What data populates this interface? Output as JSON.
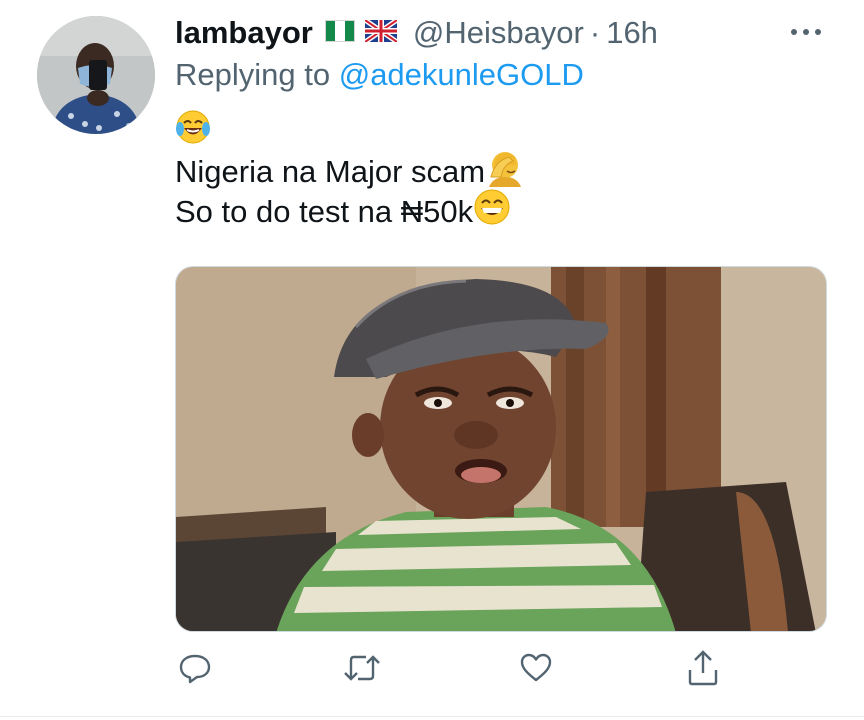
{
  "tweet": {
    "display_name": "lambayor",
    "handle": "@Heisbayor",
    "separator": "·",
    "time": "16h",
    "reply_prefix": "Replying to",
    "reply_to": "@adekunleGOLD",
    "text_lines": [
      "Nigeria na Major scam",
      "So to do test na ₦50k"
    ],
    "emojis": [
      "face-with-tears-of-joy",
      "person-facepalming",
      "grinning-face-with-smiling-eyes"
    ],
    "flags": [
      "nigeria-flag",
      "uk-flag"
    ]
  },
  "actions": [
    {
      "name": "reply-icon"
    },
    {
      "name": "retweet-icon"
    },
    {
      "name": "like-icon"
    },
    {
      "name": "share-icon"
    }
  ],
  "colors": {
    "text": "#0f1419",
    "secondary": "#536471",
    "link": "#1d9bf0",
    "border": "#cfd9de"
  }
}
